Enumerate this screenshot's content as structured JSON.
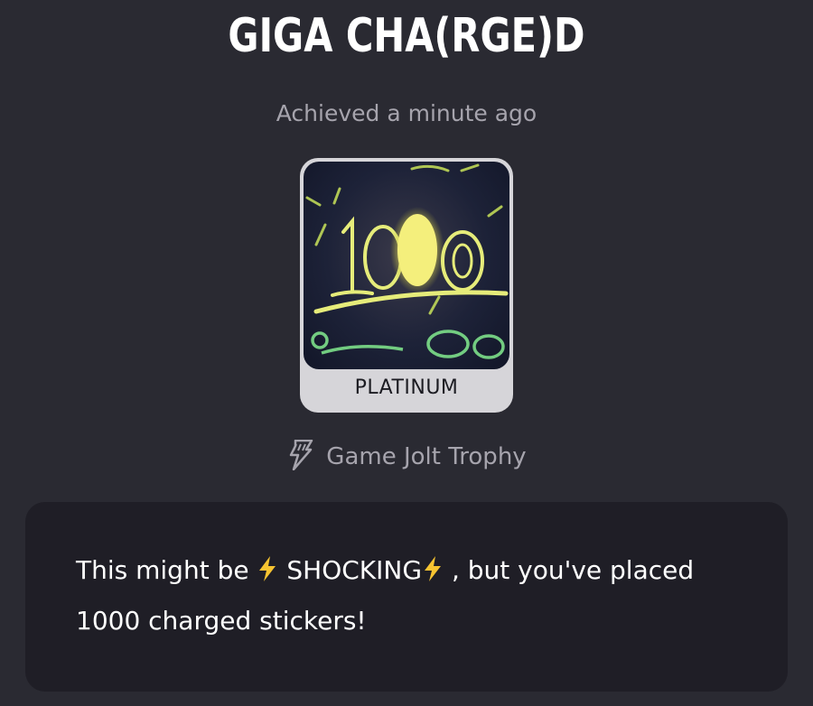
{
  "trophy": {
    "title": "GIGA CHA(RGE)D",
    "achieved_text": "Achieved a minute ago",
    "tier": "PLATINUM",
    "image_text": "1000",
    "source_label": "Game Jolt Trophy",
    "source_icon": "game-jolt-bolt-icon",
    "description": {
      "part1": "This might be ",
      "part2": " SHOCKING",
      "part3": " , but you've placed 1000 charged stickers!"
    }
  },
  "colors": {
    "background": "#2a2a32",
    "card_background": "#1f1e26",
    "muted_text": "#a6a4ad",
    "tier_card": "#d6d5d9",
    "bolt": "#f7c431"
  }
}
